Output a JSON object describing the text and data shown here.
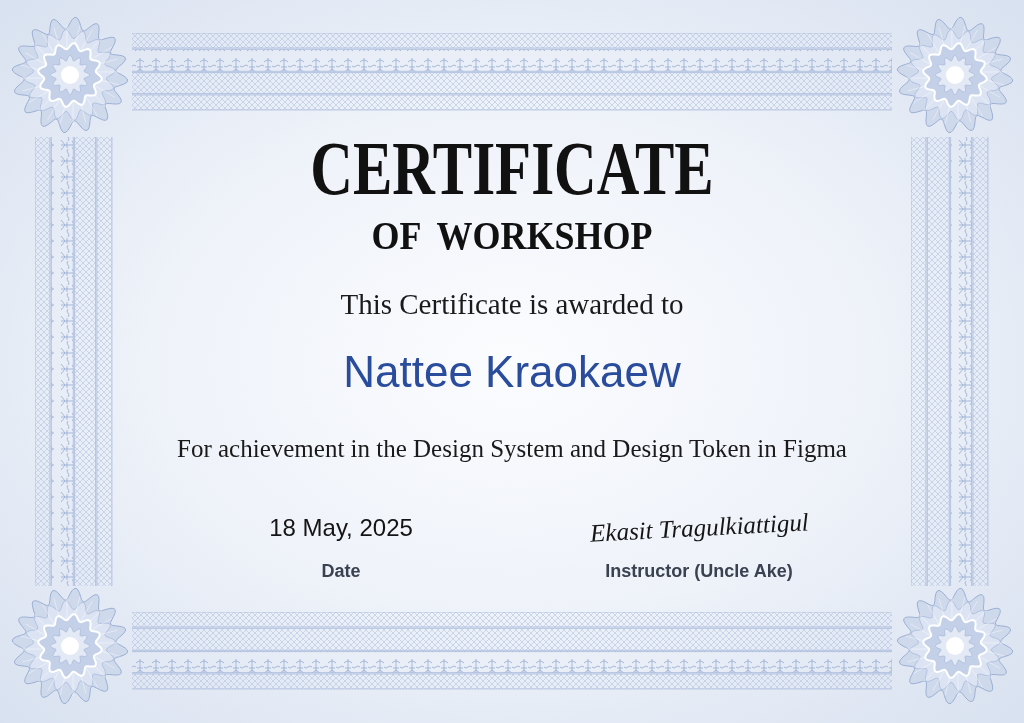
{
  "certificate": {
    "title": "CERTIFICATE",
    "subtitle": "OF WORKSHOP",
    "intro": "This Certificate is awarded to",
    "recipient": "Nattee Kraokaew",
    "description": "For achievement in the Design System and Design Token in Figma"
  },
  "signatures": [
    {
      "kind": "date",
      "value": "18 May, 2025",
      "label": "Date"
    },
    {
      "kind": "signature",
      "value": "Ekasit Tragulkiattigul",
      "label": "Instructor (Uncle Ake)"
    }
  ]
}
